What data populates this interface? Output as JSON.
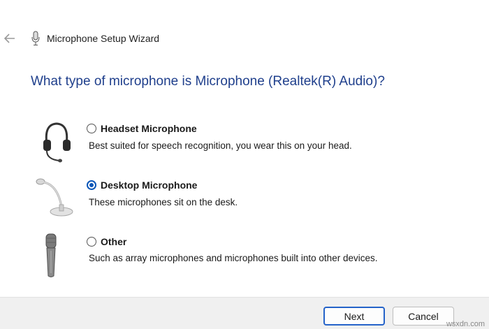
{
  "window": {
    "title": "Microphone Setup Wizard",
    "back_icon": "back-arrow-icon",
    "app_icon": "microphone-icon"
  },
  "heading": "What type of microphone is Microphone (Realtek(R) Audio)?",
  "options": [
    {
      "label": "Headset Microphone",
      "description": "Best suited for speech recognition, you wear this on your head.",
      "selected": false,
      "icon": "headset-icon"
    },
    {
      "label": "Desktop Microphone",
      "description": "These microphones sit on the desk.",
      "selected": true,
      "icon": "desktop-microphone-icon"
    },
    {
      "label": "Other",
      "description": "Such as array microphones and microphones built into other devices.",
      "selected": false,
      "icon": "handheld-microphone-icon"
    }
  ],
  "buttons": {
    "next": "Next",
    "cancel": "Cancel"
  },
  "watermark": "wsxdn.com",
  "colors": {
    "heading": "#1f3f8c",
    "accent": "#0a56b8",
    "footer_bg": "#f0f0f0"
  }
}
